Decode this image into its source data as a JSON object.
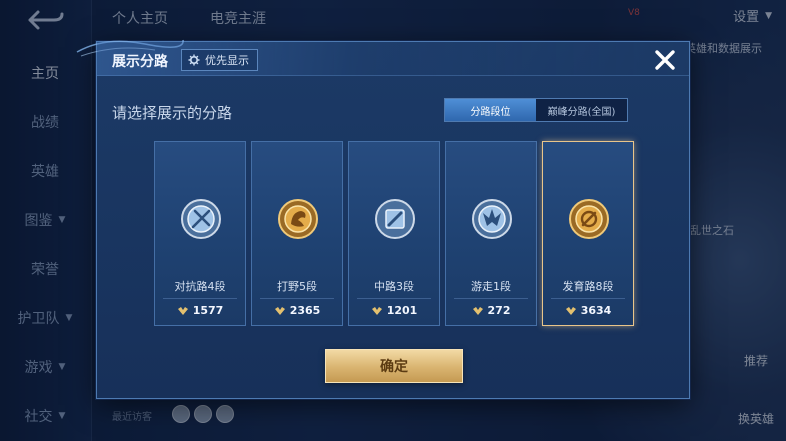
{
  "app": {
    "top_tabs": [
      "个人主页",
      "电竞主涯"
    ],
    "settings_label": "设置",
    "vip_text": "V8",
    "right_link": "英雄和数据展示",
    "right_tag": "乱世之石",
    "right_actions": [
      "推荐",
      "换英雄"
    ],
    "recent_visitors_label": "最近访客",
    "sidebar": [
      {
        "label": "主页",
        "active": true,
        "chevron": false
      },
      {
        "label": "战绩",
        "active": false,
        "chevron": false
      },
      {
        "label": "英雄",
        "active": false,
        "chevron": false
      },
      {
        "label": "图鉴",
        "active": false,
        "chevron": true
      },
      {
        "label": "荣誉",
        "active": false,
        "chevron": false
      },
      {
        "label": "护卫队",
        "active": false,
        "chevron": true
      },
      {
        "label": "游戏",
        "active": false,
        "chevron": true
      },
      {
        "label": "社交",
        "active": false,
        "chevron": true
      }
    ]
  },
  "modal": {
    "title": "展示分路",
    "priority_label": "优先显示",
    "prompt": "请选择展示的分路",
    "toggle": {
      "options": [
        "分路段位",
        "巅峰分路(全国)"
      ],
      "selected_index": 0
    },
    "lanes": [
      {
        "label": "对抗路4段",
        "score": "1577",
        "emblem": "clash-lane-icon",
        "tier": "silver"
      },
      {
        "label": "打野5段",
        "score": "2365",
        "emblem": "jungle-icon",
        "tier": "gold"
      },
      {
        "label": "中路3段",
        "score": "1201",
        "emblem": "mid-lane-icon",
        "tier": "silver"
      },
      {
        "label": "游走1段",
        "score": "272",
        "emblem": "roam-icon",
        "tier": "silver"
      },
      {
        "label": "发育路8段",
        "score": "3634",
        "emblem": "farm-lane-icon",
        "tier": "gold"
      }
    ],
    "selected_lane_index": 4,
    "confirm_label": "确定"
  },
  "colors": {
    "accent_blue": "#2f67ae",
    "gold": "#d9b470",
    "selected_border": "#e9c58a",
    "silver_emblem": "#c6d2e0",
    "gold_emblem": "#e0a440"
  }
}
